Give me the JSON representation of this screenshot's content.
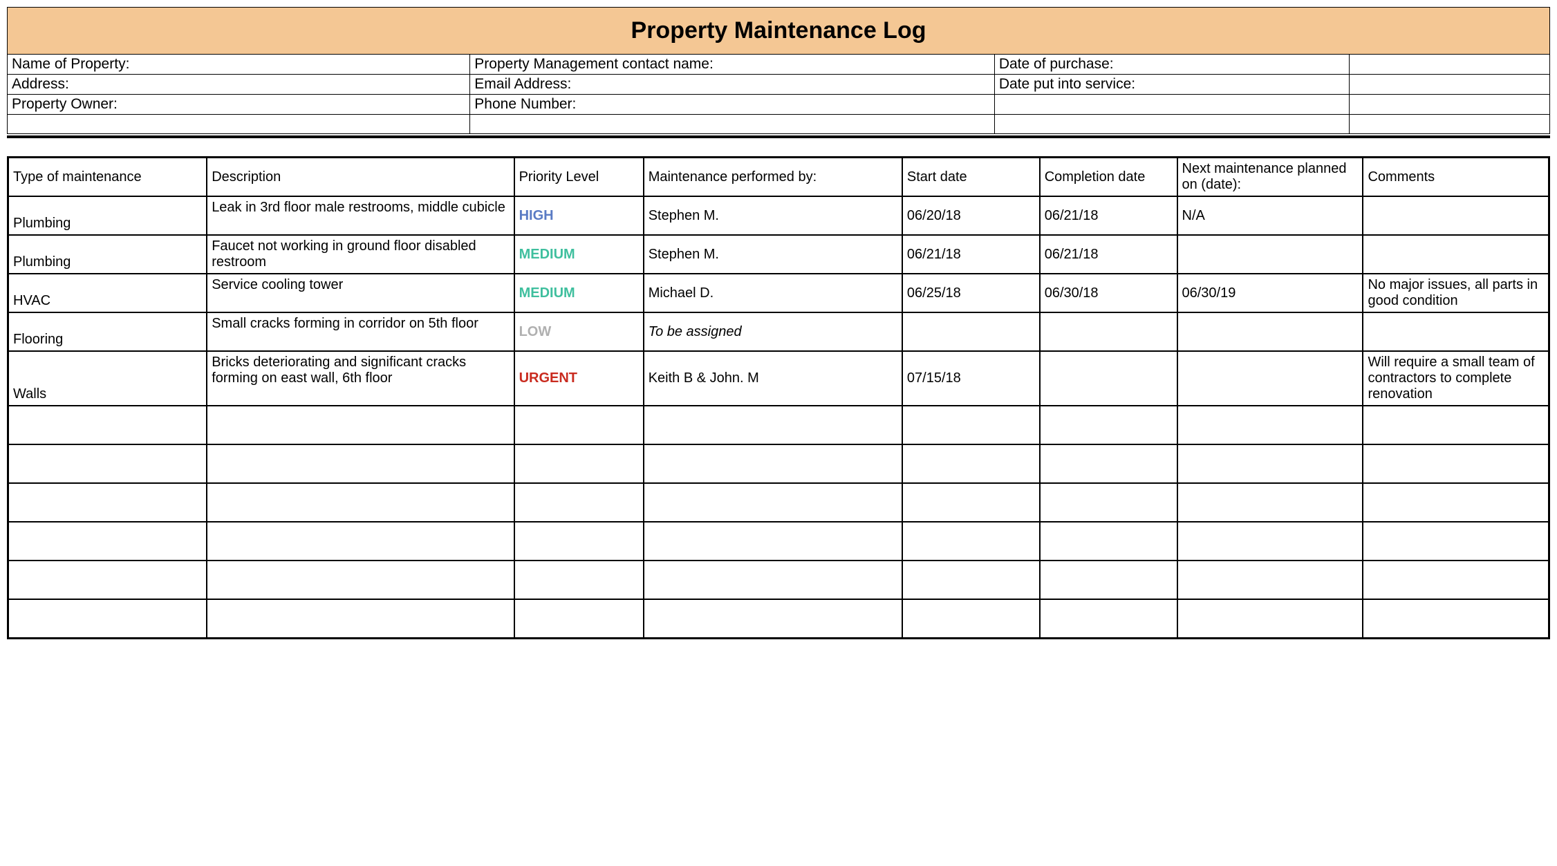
{
  "title": "Property Maintenance Log",
  "info": {
    "r1c1": "Name of Property:",
    "r1c2": "Property Management contact name:",
    "r1c3": "Date of purchase:",
    "r2c1": "Address:",
    "r2c2": "Email Address:",
    "r2c3": "Date put into service:",
    "r3c1": "Property Owner:",
    "r3c2": "Phone Number:"
  },
  "headers": {
    "type": "Type of maintenance",
    "description": "Description",
    "priority": "Priority Level",
    "performed_by": "Maintenance performed by:",
    "start": "Start date",
    "completion": "Completion date",
    "next": "Next maintenance planned on (date):",
    "comments": "Comments"
  },
  "rows": [
    {
      "type": "Plumbing",
      "description": "Leak in 3rd floor male restrooms, middle cubicle",
      "priority": "HIGH",
      "priority_class": "p-high",
      "performed_by": "Stephen M.",
      "start": "06/20/18",
      "completion": "06/21/18",
      "next": "N/A",
      "comments": "",
      "italic": false
    },
    {
      "type": "Plumbing",
      "description": "Faucet not working in ground floor disabled restroom",
      "priority": "MEDIUM",
      "priority_class": "p-medium",
      "performed_by": "Stephen M.",
      "start": "06/21/18",
      "completion": "06/21/18",
      "next": "",
      "comments": "",
      "italic": false
    },
    {
      "type": "HVAC",
      "description": "Service cooling tower",
      "priority": "MEDIUM",
      "priority_class": "p-medium",
      "performed_by": "Michael D.",
      "start": "06/25/18",
      "completion": "06/30/18",
      "next": "06/30/19",
      "comments": "No major issues, all parts in good condition",
      "italic": false
    },
    {
      "type": "Flooring",
      "description": "Small cracks forming in corridor on 5th floor",
      "priority": "LOW",
      "priority_class": "p-low",
      "performed_by": "To be assigned",
      "start": "",
      "completion": "",
      "next": "",
      "comments": "",
      "italic": true
    },
    {
      "type": "Walls",
      "description": "Bricks deteriorating and significant cracks forming on east wall, 6th floor",
      "priority": "URGENT",
      "priority_class": "p-urgent",
      "performed_by": "Keith B & John. M",
      "start": "07/15/18",
      "completion": "",
      "next": "",
      "comments": "Will require a small team of contractors to complete renovation",
      "italic": false
    },
    {
      "type": "",
      "description": "",
      "priority": "",
      "priority_class": "",
      "performed_by": "",
      "start": "",
      "completion": "",
      "next": "",
      "comments": "",
      "italic": false
    },
    {
      "type": "",
      "description": "",
      "priority": "",
      "priority_class": "",
      "performed_by": "",
      "start": "",
      "completion": "",
      "next": "",
      "comments": "",
      "italic": false
    },
    {
      "type": "",
      "description": "",
      "priority": "",
      "priority_class": "",
      "performed_by": "",
      "start": "",
      "completion": "",
      "next": "",
      "comments": "",
      "italic": false
    },
    {
      "type": "",
      "description": "",
      "priority": "",
      "priority_class": "",
      "performed_by": "",
      "start": "",
      "completion": "",
      "next": "",
      "comments": "",
      "italic": false
    },
    {
      "type": "",
      "description": "",
      "priority": "",
      "priority_class": "",
      "performed_by": "",
      "start": "",
      "completion": "",
      "next": "",
      "comments": "",
      "italic": false
    },
    {
      "type": "",
      "description": "",
      "priority": "",
      "priority_class": "",
      "performed_by": "",
      "start": "",
      "completion": "",
      "next": "",
      "comments": "",
      "italic": false
    }
  ]
}
